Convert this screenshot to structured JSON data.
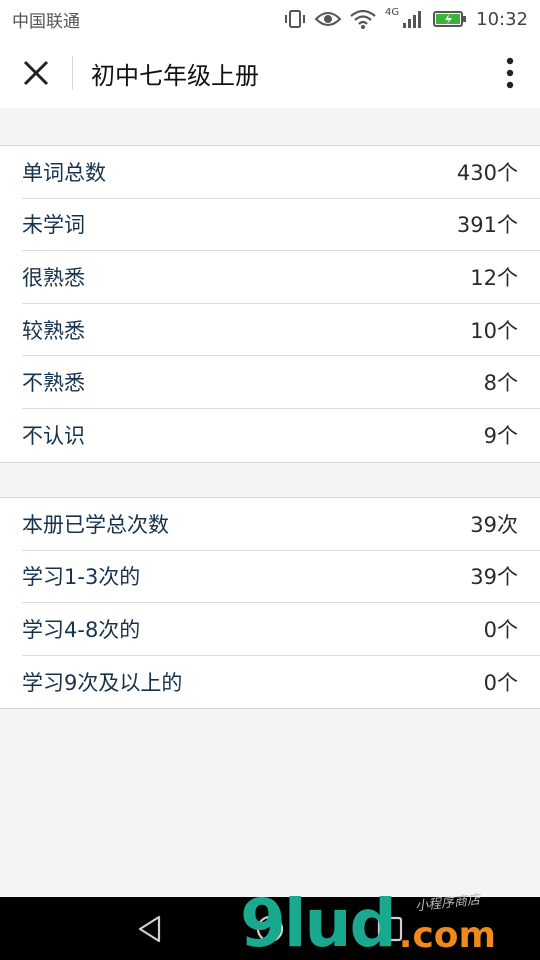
{
  "status_bar": {
    "carrier": "中国联通",
    "network": "4G",
    "time": "10:32"
  },
  "nav": {
    "title": "初中七年级上册"
  },
  "group1": [
    {
      "label": "单词总数",
      "value": "430个"
    },
    {
      "label": "未学词",
      "value": "391个"
    },
    {
      "label": "很熟悉",
      "value": "12个"
    },
    {
      "label": "较熟悉",
      "value": "10个"
    },
    {
      "label": "不熟悉",
      "value": "8个"
    },
    {
      "label": "不认识",
      "value": "9个"
    }
  ],
  "group2": [
    {
      "label": "本册已学总次数",
      "value": "39次"
    },
    {
      "label": "学习1-3次的",
      "value": "39个"
    },
    {
      "label": "学习4-8次的",
      "value": "0个"
    },
    {
      "label": "学习9次及以上的",
      "value": "0个"
    }
  ],
  "watermark": {
    "main": "9lud",
    "suffix": ".com",
    "small": "小程序商店"
  },
  "icons": {
    "close": "close-icon",
    "more": "more-vertical-icon",
    "back": "back-triangle-icon",
    "home": "home-circle-icon",
    "recents": "recents-square-icon"
  }
}
